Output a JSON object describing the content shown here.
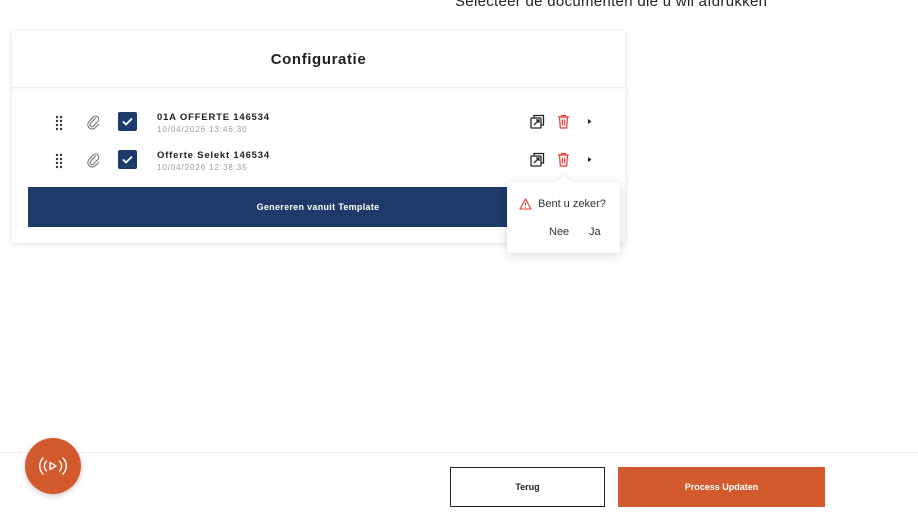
{
  "page": {
    "instruction": "Selecteer de documenten die u wil afdrukken"
  },
  "card": {
    "title": "Configuratie",
    "documents": [
      {
        "name": "01A OFFERTE 146534",
        "date": "10/04/2026 13:46:30",
        "checked": true
      },
      {
        "name": "Offerte Selekt 146534",
        "date": "10/04/2026 12:38:35",
        "checked": true
      }
    ],
    "generate_label": "Genereren vanuit Template"
  },
  "confirm": {
    "message": "Bent u zeker?",
    "no_label": "Nee",
    "yes_label": "Ja"
  },
  "footer": {
    "back_label": "Terug",
    "update_label": "Process Updaten"
  },
  "colors": {
    "navy": "#1e3a6b",
    "orange": "#d35a2c",
    "danger": "#e53935"
  },
  "icons": [
    "drag-handle-icon",
    "paperclip-icon",
    "checkbox-icon",
    "open-external-icon",
    "trash-icon",
    "caret-right-icon",
    "warning-icon",
    "broadcast-icon"
  ]
}
